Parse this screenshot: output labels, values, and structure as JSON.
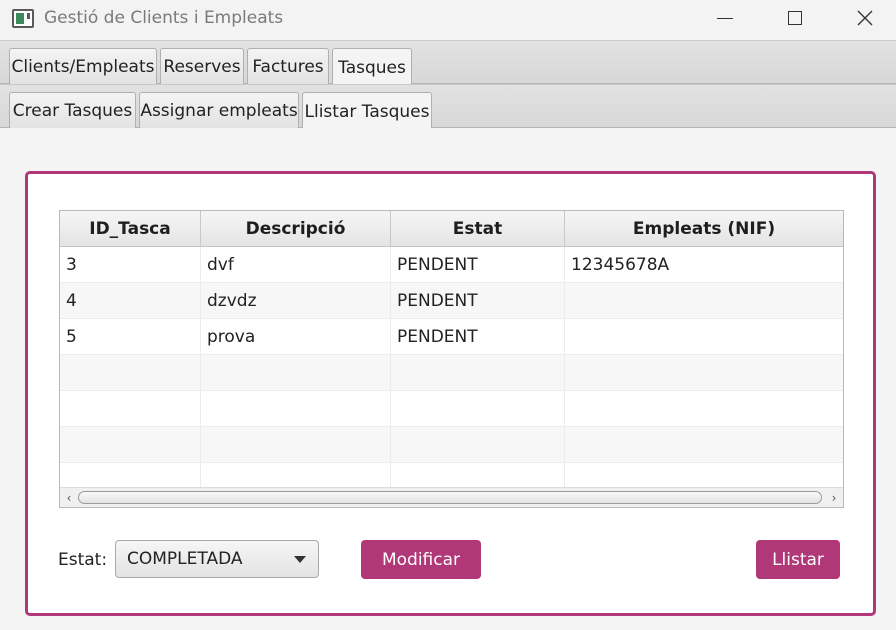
{
  "window": {
    "title": "Gestió de Clients i Empleats"
  },
  "main_tabs": [
    {
      "label": "Clients/Empleats"
    },
    {
      "label": "Reserves"
    },
    {
      "label": "Factures"
    },
    {
      "label": "Tasques"
    }
  ],
  "sub_tabs": [
    {
      "label": "Crear Tasques"
    },
    {
      "label": "Assignar empleats"
    },
    {
      "label": "Llistar Tasques"
    }
  ],
  "table": {
    "headers": [
      "ID_Tasca",
      "Descripció",
      "Estat",
      "Empleats (NIF)"
    ],
    "rows": [
      [
        "3",
        "dvf",
        "PENDENT",
        "12345678A"
      ],
      [
        "4",
        "dzvdz",
        "PENDENT",
        ""
      ],
      [
        "5",
        "prova",
        "PENDENT",
        ""
      ]
    ]
  },
  "form": {
    "estat_label": "Estat:",
    "estat_value": "COMPLETADA",
    "modify_label": "Modificar",
    "list_label": "Llistar"
  },
  "colors": {
    "accent": "#b03878"
  }
}
